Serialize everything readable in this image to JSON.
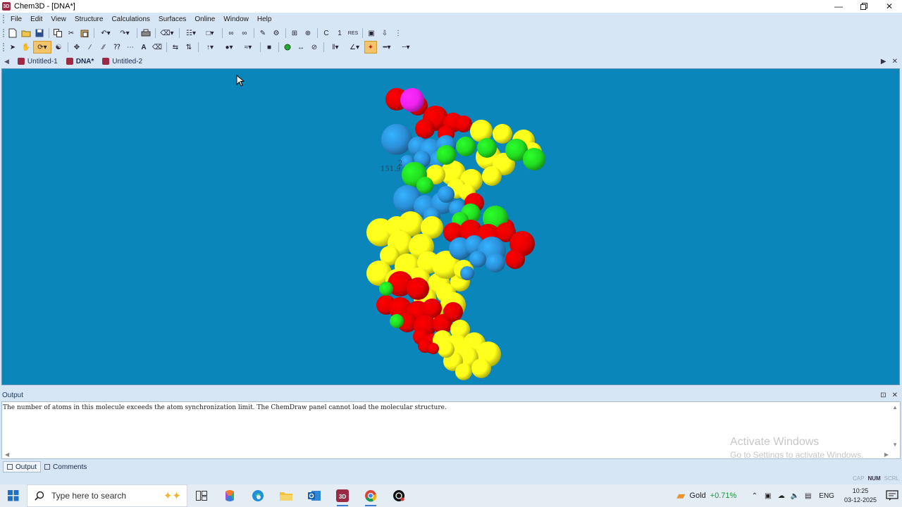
{
  "window": {
    "title": "Chem3D - [DNA*]",
    "app_icon": "3D"
  },
  "menu": [
    "File",
    "Edit",
    "View",
    "Structure",
    "Calculations",
    "Surfaces",
    "Online",
    "Window",
    "Help"
  ],
  "toolbar1": {
    "labels": {
      "c": "C",
      "one": "1",
      "res": "RES"
    }
  },
  "toolbar2": {
    "labels": {
      "text_tool": "A"
    }
  },
  "doc_tabs": [
    {
      "label": "Untitled-1",
      "active": false
    },
    {
      "label": "DNA*",
      "active": true
    },
    {
      "label": "Untitled-2",
      "active": false
    }
  ],
  "model": {
    "background": "#0b86bb",
    "measurement_labels": [
      "151.9",
      "2"
    ],
    "atom_colors": {
      "oxygen": "#e60000",
      "nitrogen": "#2b8fd8",
      "carbon": "#ffff1a",
      "phosphorus": "#22dd22",
      "highlight": "#ee22ee"
    }
  },
  "output": {
    "title": "Output",
    "message": "The number of atoms in this molecule exceeds the atom synchronization limit. The ChemDraw panel cannot load the molecular structure."
  },
  "watermark": {
    "title": "Activate Windows",
    "subtitle": "Go to Settings to activate Windows."
  },
  "panel_tabs": [
    {
      "label": "Output",
      "active": true
    },
    {
      "label": "Comments",
      "active": false
    }
  ],
  "status_flags": [
    {
      "label": "CAP",
      "on": false
    },
    {
      "label": "NUM",
      "on": true
    },
    {
      "label": "SCRL",
      "on": false
    }
  ],
  "taskbar": {
    "search_placeholder": "Type here to search",
    "stock": {
      "name": "Gold",
      "change": "+0.71%"
    },
    "language": "ENG",
    "time": "10:25",
    "date": "03-12-2025"
  }
}
